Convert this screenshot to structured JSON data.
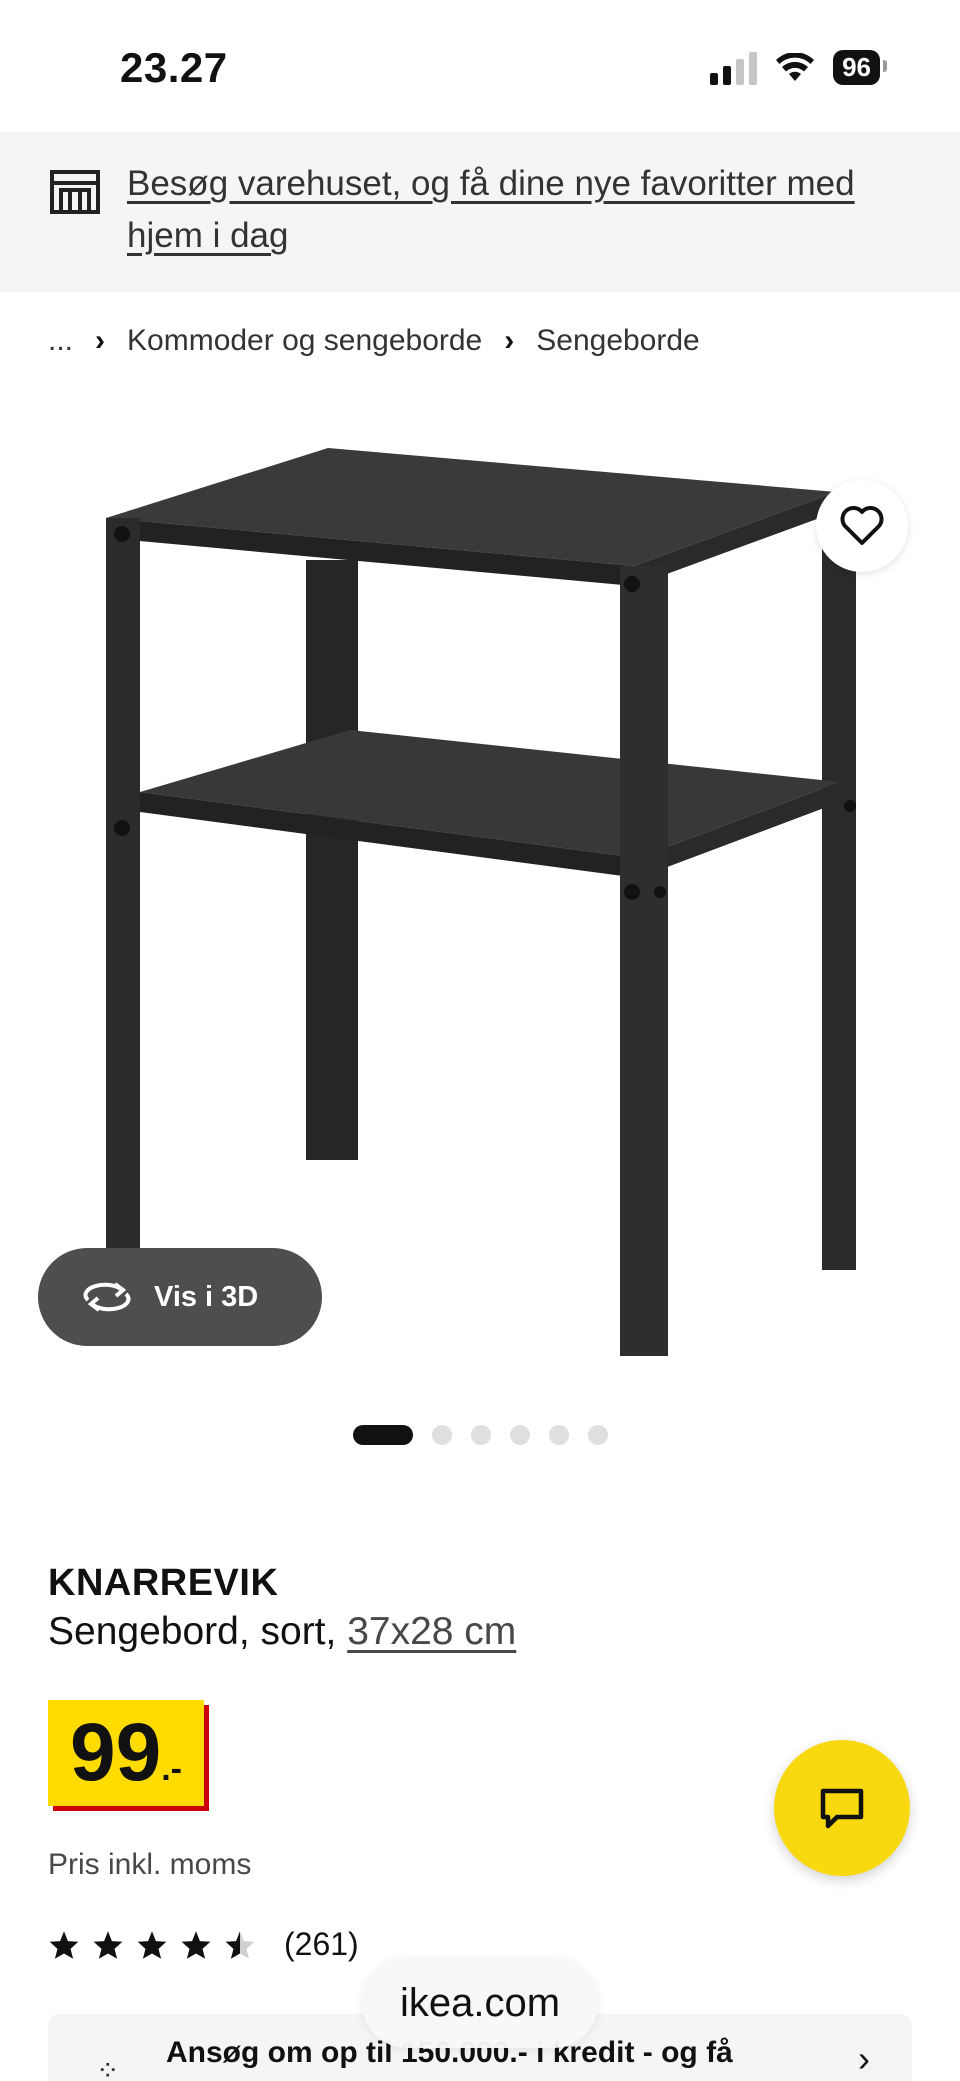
{
  "status_bar": {
    "time": "23.27",
    "battery": "96"
  },
  "store_banner": {
    "text": "Besøg varehuset, og få dine nye favoritter med hjem i dag",
    "icon": "store-icon"
  },
  "breadcrumb": {
    "ellipsis": "...",
    "items": [
      "Kommoder og sengeborde",
      "Sengeborde"
    ],
    "separator": "›"
  },
  "image": {
    "view3d_label": "Vis i 3D",
    "dots_count": 6,
    "active_dot": 0
  },
  "product": {
    "name": "KNARREVIK",
    "description": "Sengebord, sort, ",
    "size": "37x28 cm",
    "price": "99",
    "price_suffix": ".-",
    "price_note": "Pris inkl. moms",
    "rating_value": 4.5,
    "rating_count": "(261)"
  },
  "credit": {
    "text": "Ansøg om op til 150.000.- i kredit - og få",
    "chevron": "›"
  },
  "browser": {
    "url": "ikea.com"
  },
  "colors": {
    "price_yellow": "#ffdb00",
    "price_shadow": "#cc0008",
    "chat_fab": "#f8d80e"
  }
}
